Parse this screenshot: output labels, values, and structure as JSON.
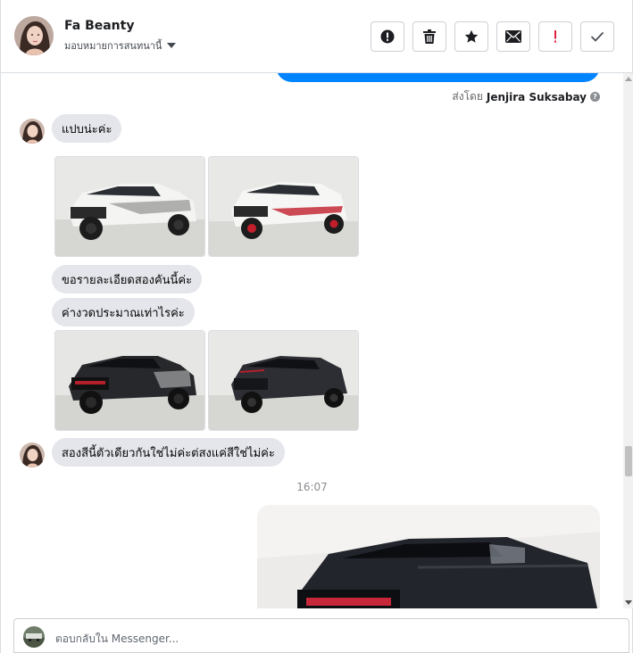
{
  "header": {
    "contact_name": "Fa Beanty",
    "assign_label": "มอบหมายการสนทนานี้",
    "actions": [
      {
        "name": "report-icon"
      },
      {
        "name": "trash-icon"
      },
      {
        "name": "star-icon"
      },
      {
        "name": "mail-icon"
      },
      {
        "name": "spam-icon"
      },
      {
        "name": "check-icon"
      }
    ]
  },
  "chat": {
    "sent_by_prefix": "ส่งโดย",
    "sent_by_name": "Jenjira Suksabay",
    "messages": [
      {
        "text": "แปบน่ะค่ะ"
      },
      {
        "text": "ขอรายละเอียดสองคันนี้ค่ะ"
      },
      {
        "text": "ค่างวดประมาณเท่าไรค่ะ"
      },
      {
        "text": "สองสีนี้ตัวเดียวกันใช่ไม่ค่ะต่สงแค่สีใช่ไม่ค่ะ"
      }
    ],
    "timestamp": "16:07"
  },
  "composer": {
    "placeholder": "ตอบกลับใน Messenger..."
  },
  "colors": {
    "sent_bubble": "#0084ff",
    "received_bubble": "#e4e6eb",
    "spam_red": "#e41e3f"
  }
}
